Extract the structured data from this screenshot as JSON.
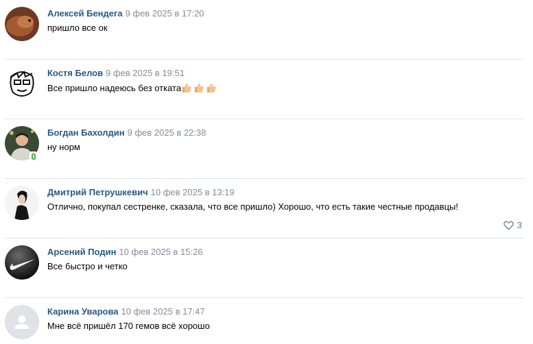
{
  "comments": [
    {
      "author": "Алексей Бендега",
      "date": "9 фев 2025 в 17:20",
      "text": "пришло все ок",
      "avatar_icon": "user-photo-icon",
      "avatar_color": "#8a4a2a"
    },
    {
      "author": "Костя Белов",
      "date": "9 фев 2025 в 19:51",
      "text": "Все пришло надеюсь без отката",
      "emoji": [
        "thumbs-up-icon",
        "thumbs-up-icon",
        "thumbs-up-icon"
      ],
      "avatar_icon": "drawn-face-icon",
      "avatar_color": "#ffffff"
    },
    {
      "author": "Богдан Бахолдин",
      "date": "9 фев 2025 в 22:38",
      "text": "ну норм",
      "online_mobile": true,
      "avatar_icon": "user-photo-icon",
      "avatar_color": "#2f3a2c"
    },
    {
      "author": "Дмитрий Петрушкевич",
      "date": "10 фев 2025 в 13:19",
      "text": "Отлично, покупал сестренке, сказала, что все пришло) Хорошо, что есть такие честные продавцы!",
      "likes": "3",
      "avatar_icon": "user-photo-icon",
      "avatar_color": "#f2f2f2"
    },
    {
      "author": "Арсений Подин",
      "date": "10 фев 2025 в 15:26",
      "text": "Все быстро и четко",
      "avatar_icon": "swoosh-logo-icon",
      "avatar_color": "#1a1a1a"
    },
    {
      "author": "Карина Уварова",
      "date": "10 фев 2025 в 17:47",
      "text": "Мне всё пришёл 170 гемов всё хорошо",
      "avatar_icon": "default-user-icon",
      "avatar_color": "#c4c8cc"
    }
  ]
}
